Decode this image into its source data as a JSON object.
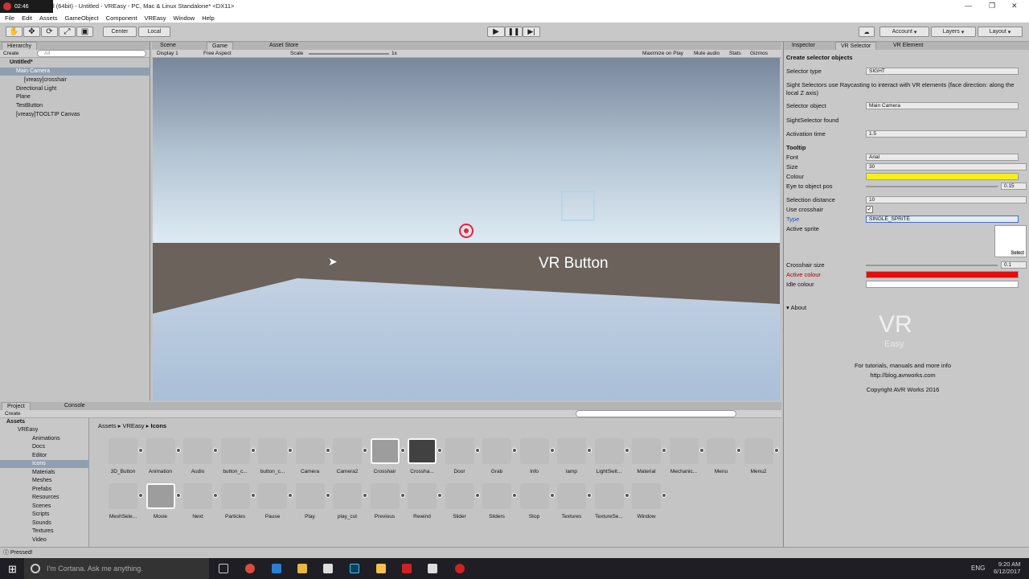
{
  "titlebar": {
    "rec_time": "02:46",
    "title": "l (64bit) - Untitled - VREasy - PC, Mac & Linux Standalone* <DX11>"
  },
  "menu": [
    "File",
    "Edit",
    "Assets",
    "GameObject",
    "Component",
    "VREasy",
    "Window",
    "Help"
  ],
  "toolbar": {
    "pivot": "Center",
    "space": "Local",
    "account": "Account",
    "layers": "Layers",
    "layout": "Layout"
  },
  "hierarchy": {
    "tab": "Hierarchy",
    "create": "Create",
    "search_placeholder": "All",
    "scene": "Untitled*",
    "items": [
      "Main Camera",
      "[vreasy]crosshair",
      "Directional Light",
      "Plane",
      "TestButton",
      "[vreasy]TOOLTIP Canvas"
    ]
  },
  "scene_tabs": {
    "scene": "Scene",
    "game": "Game",
    "store": "Asset Store"
  },
  "game_bar": {
    "display": "Display 1",
    "aspect": "Free Aspect",
    "scale_label": "Scale",
    "scale_value": "1x",
    "maximize": "Maximize on Play",
    "mute": "Mute audio",
    "stats": "Stats",
    "gizmos": "Gizmos"
  },
  "viewport": {
    "button_text": "VR Button"
  },
  "inspector": {
    "tabs": [
      "Inspector",
      "VR Selector",
      "VR Element"
    ],
    "heading": "Create selector objects",
    "selector_type_label": "Selector type",
    "selector_type": "SIGHT",
    "desc": "Sight Selectors use Raycasting to interact with VR elements (face direction: along the local Z axis)",
    "selector_object_label": "Selector object",
    "selector_object": "Main Camera",
    "found": "SightSelector found",
    "activation_label": "Activation time",
    "activation": "1.5",
    "tooltip": "Tooltip",
    "font_label": "Font",
    "font": "Arial",
    "size_label": "Size",
    "size": "30",
    "colour_label": "Colour",
    "colour": "#f5f019",
    "eye_label": "Eye to object pos",
    "eye": "0.15",
    "seldist_label": "Selection distance",
    "seldist": "10",
    "usecross_label": "Use crosshair",
    "type_label": "Type",
    "type": "SINGLE_SPRITE",
    "sprite_label": "Active sprite",
    "sprite_select": "Select",
    "crosssize_label": "Crosshair size",
    "crosssize": "0.1",
    "active_colour_label": "Active colour",
    "active_colour": "#e50d0d",
    "idle_colour_label": "Idle colour",
    "idle_colour": "#ffffff",
    "about": "About",
    "logo_text": "VR",
    "logo_sub": "Easy",
    "about_line1": "For tutorials, manuals and more info",
    "about_line2": "http://blog.avrworks.com",
    "about_line3": "Copyright AVR Works 2016"
  },
  "project": {
    "tab": "Project",
    "console": "Console",
    "create": "Create",
    "breadcrumb": [
      "Assets",
      "VREasy",
      "Icons"
    ],
    "tree": [
      "Assets",
      "VREasy",
      "Animations",
      "Docs",
      "Editor",
      "Icons",
      "Materials",
      "Meshes",
      "Prefabs",
      "Resources",
      "Scenes",
      "Scripts",
      "Sounds",
      "Textures",
      "Video"
    ],
    "assets_row1": [
      "3D_Button",
      "Animation",
      "Audio",
      "button_c...",
      "button_c...",
      "Camera",
      "Camera2",
      "Crosshair",
      "Crossha...",
      "Door",
      "Grab",
      "Info",
      "lamp",
      "LightSwit...",
      "Material",
      "Mechanic...",
      "Menu",
      "Menu2"
    ],
    "assets_row2": [
      "MeshSele...",
      "Movie",
      "Next",
      "Particles",
      "Pause",
      "Play",
      "play_cut",
      "Previous",
      "Rewind",
      "Slider",
      "Sliders",
      "Stop",
      "Textures",
      "TextureSe...",
      "Window"
    ]
  },
  "status": "Pressed!",
  "taskbar": {
    "search": "I'm Cortana. Ask me anything.",
    "lang": "ENG",
    "time": "9:20 AM",
    "date": "6/12/2017"
  }
}
